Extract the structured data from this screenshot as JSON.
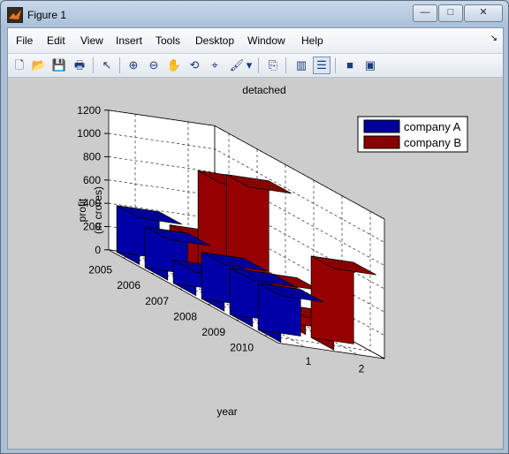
{
  "window": {
    "title": "Figure 1",
    "buttons": {
      "minimize": "—",
      "maximize": "□",
      "close": "✕"
    }
  },
  "menu": [
    "File",
    "Edit",
    "View",
    "Insert",
    "Tools",
    "Desktop",
    "Window",
    "Help"
  ],
  "menu_arrow": "↘",
  "toolbar": [
    {
      "name": "new-figure-icon",
      "glyph": "🗋"
    },
    {
      "name": "open-file-icon",
      "glyph": "📂"
    },
    {
      "name": "save-icon",
      "glyph": "💾"
    },
    {
      "name": "print-icon",
      "glyph": "🖶"
    },
    {
      "name": "edit-plot-arrow-icon",
      "glyph": "↖"
    },
    {
      "name": "zoom-in-icon",
      "glyph": "⊕"
    },
    {
      "name": "zoom-out-icon",
      "glyph": "⊖"
    },
    {
      "name": "pan-hand-icon",
      "glyph": "✋"
    },
    {
      "name": "rotate-3d-icon",
      "glyph": "⟲"
    },
    {
      "name": "data-cursor-icon",
      "glyph": "⌖"
    },
    {
      "name": "brush-icon",
      "glyph": "🖌"
    },
    {
      "name": "brush-dropdown-icon",
      "glyph": "▾"
    },
    {
      "name": "link-plot-icon",
      "glyph": "⎘"
    },
    {
      "name": "colorbar-icon",
      "glyph": "▥"
    },
    {
      "name": "legend-icon",
      "glyph": "☰"
    },
    {
      "name": "hide-plot-tools-icon",
      "glyph": "■"
    },
    {
      "name": "show-plot-tools-icon",
      "glyph": "▣"
    }
  ],
  "chart_data": {
    "type": "bar",
    "title": "detached",
    "zlabel_lines": [
      "profit",
      "(in crores)"
    ],
    "xlabel": "year",
    "z_ticks": [
      "0",
      "200",
      "400",
      "600",
      "800",
      "1000",
      "1200"
    ],
    "zlim": [
      0,
      1200
    ],
    "categories": [
      "2005",
      "2006",
      "2007",
      "2008",
      "2009",
      "2010"
    ],
    "group_ticks": [
      "1",
      "2"
    ],
    "series": [
      {
        "name": "company A",
        "color": "#000099",
        "values": [
          400,
          350,
          200,
          400,
          400,
          400
        ]
      },
      {
        "name": "company B",
        "color": "#880000",
        "values": [
          300,
          900,
          1000,
          300,
          150,
          700
        ]
      }
    ],
    "legend_position": "top-right",
    "grid": true
  }
}
